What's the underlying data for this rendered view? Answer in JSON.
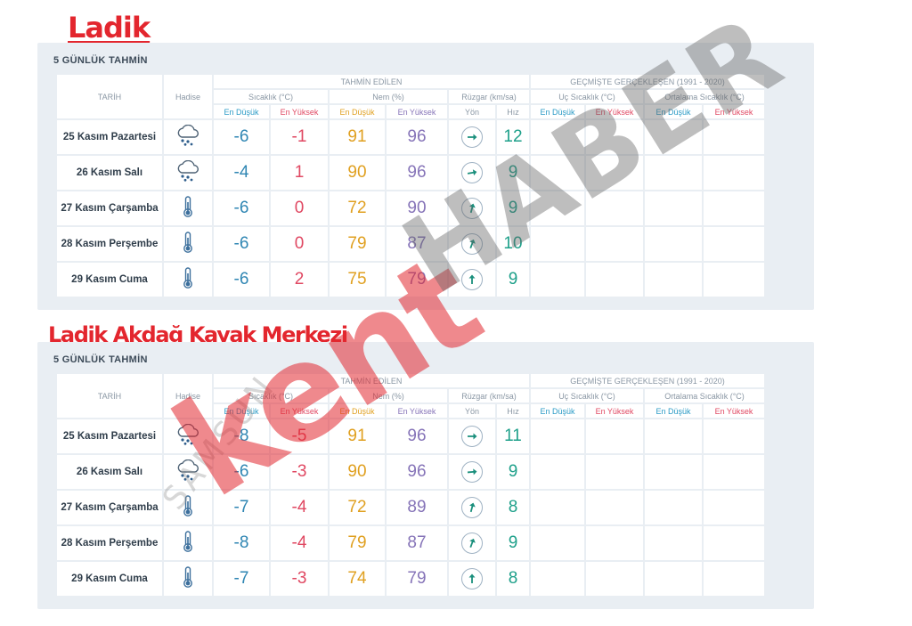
{
  "headings": [
    "Ladik",
    "Ladik Akdağ Kayak Merkezi"
  ],
  "panel_title": "5 GÜNLÜK TAHMİN",
  "header": {
    "date_col": "TARİH",
    "event_col": "Hadise",
    "forecast_group": "TAHMİN EDİLEN",
    "history_group": "GEÇMİŞTE GERÇEKLEŞEN (1991 - 2020)",
    "temp": "Sıcaklık (°C)",
    "humidity": "Nem (%)",
    "wind": "Rüzgar (km/sa)",
    "extreme_temp": "Uç Sıcaklık (°C)",
    "avg_temp": "Ortalama Sıcaklık (°C)",
    "low": "En Düşük",
    "high": "En Yüksek",
    "direction": "Yön",
    "speed": "Hız"
  },
  "tables": [
    {
      "rows": [
        {
          "date": "25 Kasım Pazartesi",
          "icon": "snow-cloud-icon",
          "tmin": "-6",
          "tmax": "-1",
          "hmin": "91",
          "hmax": "96",
          "wind_dir_deg": 90,
          "speed": "12"
        },
        {
          "date": "26 Kasım Salı",
          "icon": "snow-cloud-icon",
          "tmin": "-4",
          "tmax": "1",
          "hmin": "90",
          "hmax": "96",
          "wind_dir_deg": 80,
          "speed": "9"
        },
        {
          "date": "27 Kasım Çarşamba",
          "icon": "thermometer-icon",
          "tmin": "-6",
          "tmax": "0",
          "hmin": "72",
          "hmax": "90",
          "wind_dir_deg": 15,
          "speed": "9"
        },
        {
          "date": "28 Kasım Perşembe",
          "icon": "thermometer-icon",
          "tmin": "-6",
          "tmax": "0",
          "hmin": "79",
          "hmax": "87",
          "wind_dir_deg": 20,
          "speed": "10"
        },
        {
          "date": "29 Kasım Cuma",
          "icon": "thermometer-icon",
          "tmin": "-6",
          "tmax": "2",
          "hmin": "75",
          "hmax": "79",
          "wind_dir_deg": 0,
          "speed": "9"
        }
      ]
    },
    {
      "rows": [
        {
          "date": "25 Kasım Pazartesi",
          "icon": "snow-cloud-icon",
          "tmin": "-8",
          "tmax": "-5",
          "hmin": "91",
          "hmax": "96",
          "wind_dir_deg": 90,
          "speed": "11"
        },
        {
          "date": "26 Kasım Salı",
          "icon": "snow-cloud-icon",
          "tmin": "-6",
          "tmax": "-3",
          "hmin": "90",
          "hmax": "96",
          "wind_dir_deg": 85,
          "speed": "9"
        },
        {
          "date": "27 Kasım Çarşamba",
          "icon": "thermometer-icon",
          "tmin": "-7",
          "tmax": "-4",
          "hmin": "72",
          "hmax": "89",
          "wind_dir_deg": 15,
          "speed": "8"
        },
        {
          "date": "28 Kasım Perşembe",
          "icon": "thermometer-icon",
          "tmin": "-8",
          "tmax": "-4",
          "hmin": "79",
          "hmax": "87",
          "wind_dir_deg": 20,
          "speed": "9"
        },
        {
          "date": "29 Kasım Cuma",
          "icon": "thermometer-icon",
          "tmin": "-7",
          "tmax": "-3",
          "hmin": "74",
          "hmax": "79",
          "wind_dir_deg": 0,
          "speed": "8"
        }
      ]
    }
  ],
  "watermark": {
    "top": "SAMSUN",
    "main": "kent",
    "secondary": "HABER"
  },
  "colors": {
    "heading": "#e3262e",
    "low": "#2f86b3",
    "high": "#e04862",
    "humidity": "#e0a020",
    "humidity_high": "#8674b8",
    "speed": "#1ea08a"
  }
}
